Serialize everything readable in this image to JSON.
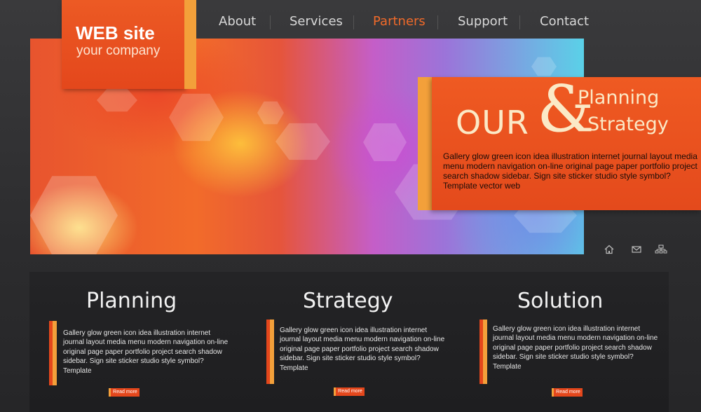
{
  "nav": {
    "items": [
      {
        "label": "About"
      },
      {
        "label": "Services"
      },
      {
        "label": "Partners"
      },
      {
        "label": "Support"
      },
      {
        "label": "Contact"
      }
    ],
    "active_index": 2
  },
  "logo": {
    "title": "WEB site",
    "subtitle": "your company"
  },
  "promo": {
    "our": "OUR",
    "ampersand": "&",
    "line1": "Planning",
    "line2": "Strategy",
    "text": "Gallery glow green icon idea illustration internet journal layout media menu modern navigation on-line original page paper portfolio project search shadow sidebar. Sign site sticker studio style symbol? Template vector web"
  },
  "utility_icons": [
    "home-icon",
    "mail-icon",
    "sitemap-icon"
  ],
  "columns": [
    {
      "title": "Planning",
      "text": "Gallery glow green icon idea illustration internet journal layout media menu modern navigation on-line original page paper portfolio project search shadow sidebar. Sign site sticker studio style symbol? Template",
      "button": "Read more"
    },
    {
      "title": "Strategy",
      "text": "Gallery glow green icon idea illustration internet journal layout media menu modern navigation on-line original page paper portfolio project search shadow sidebar. Sign site sticker studio style symbol? Template",
      "button": "Read more"
    },
    {
      "title": "Solution",
      "text": "Gallery glow green icon idea illustration internet journal layout media menu modern navigation on-line original page paper portfolio project search shadow sidebar. Sign site sticker studio style symbol? Template",
      "button": "Read more"
    }
  ],
  "colors": {
    "accent_orange": "#e4471c",
    "accent_yellow": "#f3a03a",
    "background": "#2c2c2e"
  }
}
